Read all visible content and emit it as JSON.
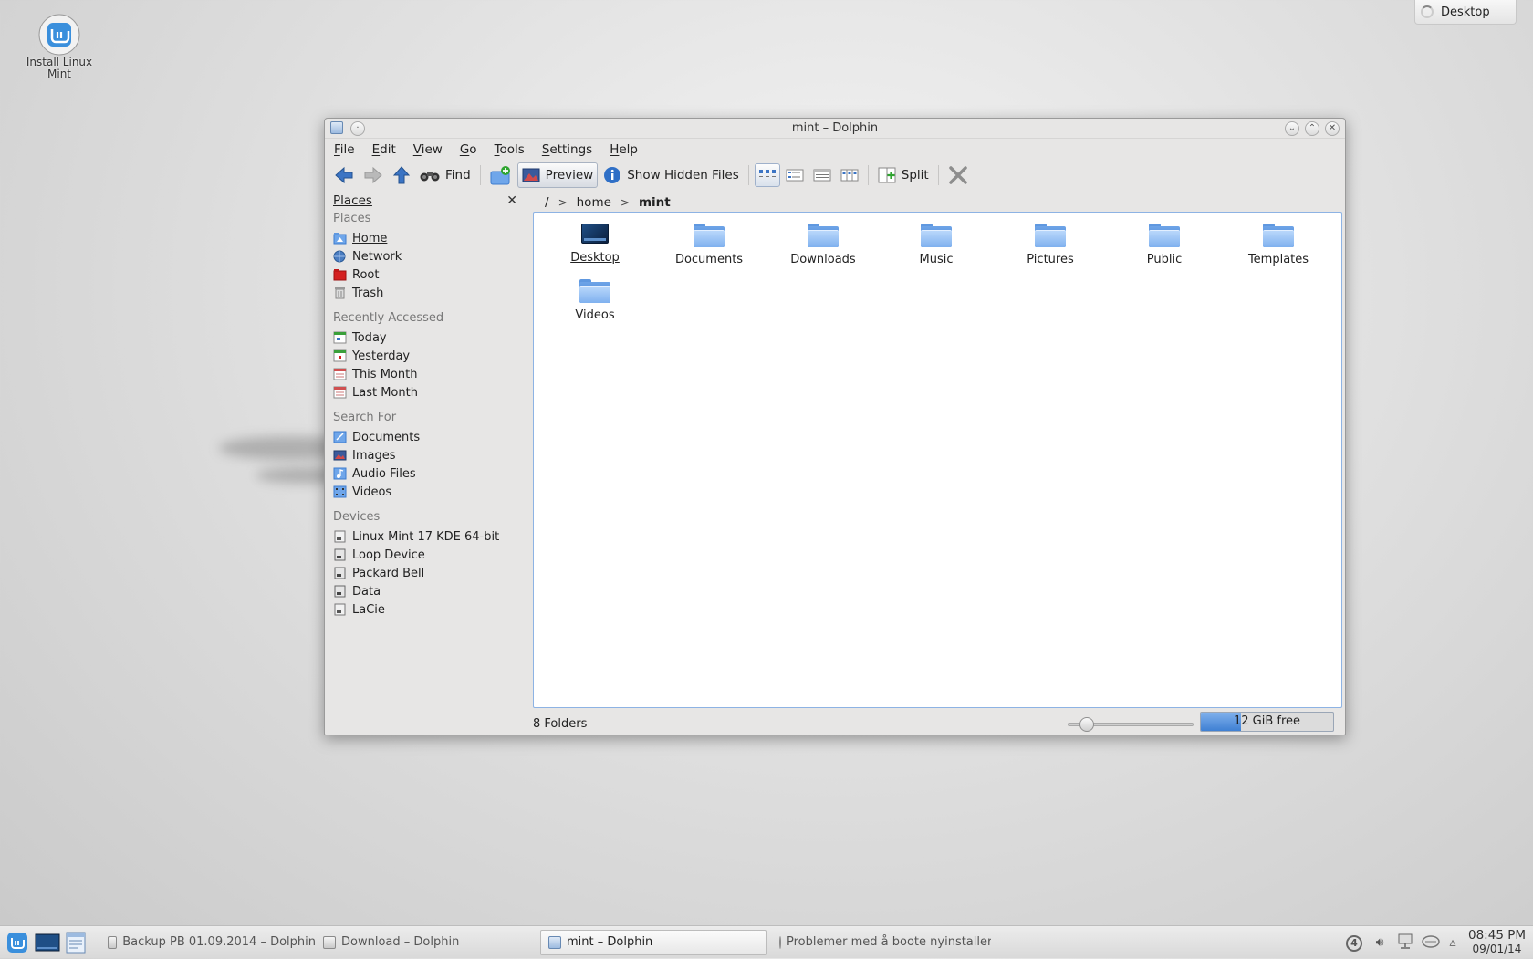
{
  "desktop": {
    "icon_label": "Install Linux Mint",
    "pager_label": "Desktop"
  },
  "window": {
    "title": "mint – Dolphin",
    "menu": [
      "File",
      "Edit",
      "View",
      "Go",
      "Tools",
      "Settings",
      "Help"
    ],
    "toolbar": {
      "find": "Find",
      "preview": "Preview",
      "show_hidden": "Show Hidden Files",
      "split": "Split"
    },
    "places_panel": {
      "title": "Places",
      "sections": [
        {
          "heading": "Places",
          "items": [
            {
              "label": "Home",
              "icon": "home-icon"
            },
            {
              "label": "Network",
              "icon": "network-icon"
            },
            {
              "label": "Root",
              "icon": "root-folder-icon"
            },
            {
              "label": "Trash",
              "icon": "trash-icon"
            }
          ]
        },
        {
          "heading": "Recently Accessed",
          "items": [
            {
              "label": "Today",
              "icon": "calendar-icon"
            },
            {
              "label": "Yesterday",
              "icon": "calendar-icon"
            },
            {
              "label": "This Month",
              "icon": "calendar-icon"
            },
            {
              "label": "Last Month",
              "icon": "calendar-icon"
            }
          ]
        },
        {
          "heading": "Search For",
          "items": [
            {
              "label": "Documents",
              "icon": "document-icon"
            },
            {
              "label": "Images",
              "icon": "image-icon"
            },
            {
              "label": "Audio Files",
              "icon": "audio-icon"
            },
            {
              "label": "Videos",
              "icon": "video-icon"
            }
          ]
        },
        {
          "heading": "Devices",
          "items": [
            {
              "label": "Linux Mint 17 KDE 64-bit",
              "icon": "drive-icon"
            },
            {
              "label": "Loop Device",
              "icon": "drive-icon"
            },
            {
              "label": "Packard Bell",
              "icon": "drive-icon"
            },
            {
              "label": "Data",
              "icon": "drive-icon"
            },
            {
              "label": "LaCie",
              "icon": "drive-icon"
            }
          ]
        }
      ]
    },
    "breadcrumb": {
      "root": "/",
      "parts": [
        "home",
        "mint"
      ]
    },
    "files": [
      "Desktop",
      "Documents",
      "Downloads",
      "Music",
      "Pictures",
      "Public",
      "Templates",
      "Videos"
    ],
    "status": {
      "summary": "8 Folders",
      "free_space": "12 GiB free",
      "free_space_used_fraction": 0.3,
      "zoom_fraction": 0.15
    }
  },
  "taskbar": {
    "tasks": [
      {
        "label": "Backup PB 01.09.2014 – Dolphin",
        "active": false
      },
      {
        "label": "Download – Dolphin",
        "active": false
      },
      {
        "label": "mint – Dolphin",
        "active": true
      },
      {
        "label": "Problemer med å boote nyinstallert",
        "active": false
      }
    ],
    "tray_badge": "4",
    "time": "08:45 PM",
    "date": "09/01/14"
  },
  "colors": {
    "accent": "#3f80d3",
    "selection_border": "#8db3e4",
    "root_red": "#d42020"
  }
}
